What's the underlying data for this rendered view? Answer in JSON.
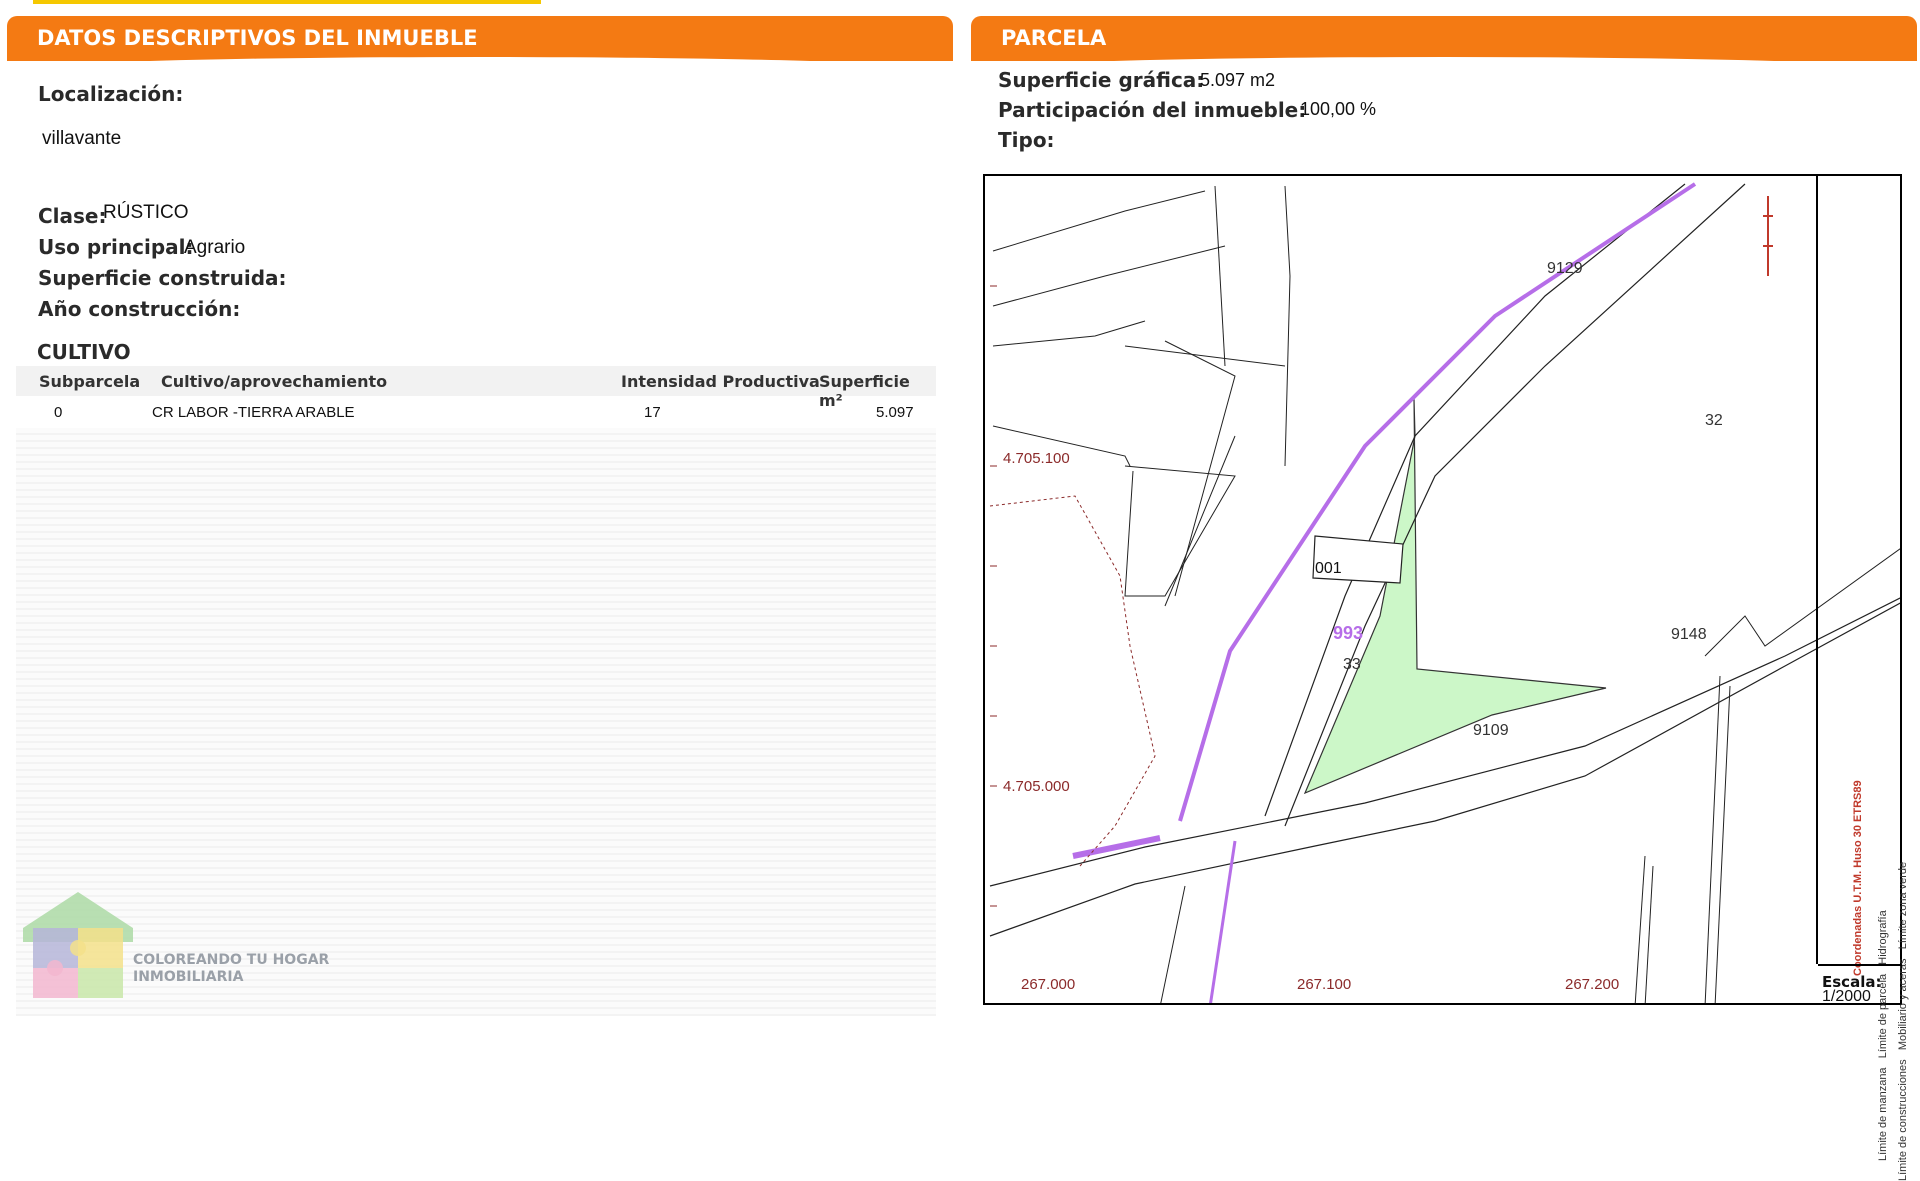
{
  "left_panel": {
    "header": "DATOS DESCRIPTIVOS DEL INMUEBLE",
    "localizacion_label": "Localización:",
    "localizacion_value": "villavante",
    "clase_label": "Clase:",
    "clase_value": "RÚSTICO",
    "uso_label": "Uso principal:",
    "uso_value": "Agrario",
    "superficie_construida_label": "Superficie construida:",
    "anio_label": "Año construcción:",
    "cultivo_title": "CULTIVO",
    "table": {
      "columns": [
        "Subparcela",
        "Cultivo/aprovechamiento",
        "Intensidad Productiva",
        "Superficie m²"
      ],
      "rows": [
        [
          "0",
          "CR LABOR -TIERRA ARABLE",
          "17",
          "5.097"
        ]
      ]
    },
    "logo": {
      "line1": "COLOREANDO TU HOGAR",
      "line2": "INMOBILIARIA",
      "icon": "puzzle-house-icon"
    }
  },
  "right_panel": {
    "header": "PARCELA",
    "superficie_grafica_label": "Superficie gráfica:",
    "superficie_grafica_value": "5.097 m2",
    "participacion_label": "Participación del inmueble:",
    "participacion_value": "100,00 %",
    "tipo_label": "Tipo:",
    "map": {
      "parcel_labels": [
        "9129",
        "32",
        "001",
        "993",
        "33",
        "9148",
        "9109"
      ],
      "y_coords": [
        "4.705.100",
        "4.705.000"
      ],
      "x_coords": [
        "267.000",
        "267.100",
        "267.200"
      ],
      "legend": [
        "Límite de manzana",
        "Límite de construcciones",
        "Límite de parcela",
        "Mobiliario y aceras",
        "Hidrografía",
        "Límite zona verde"
      ],
      "coord_system": "Coordenadas U.T.M. Huso 30 ETRS89",
      "escala_label": "Escala:",
      "escala_value": "1/2000"
    }
  },
  "colors": {
    "header": "#f47a13",
    "parcel_fill": "#ccf7c8",
    "hydro": "#b66ee8",
    "coord_text": "#8b2a2a"
  }
}
